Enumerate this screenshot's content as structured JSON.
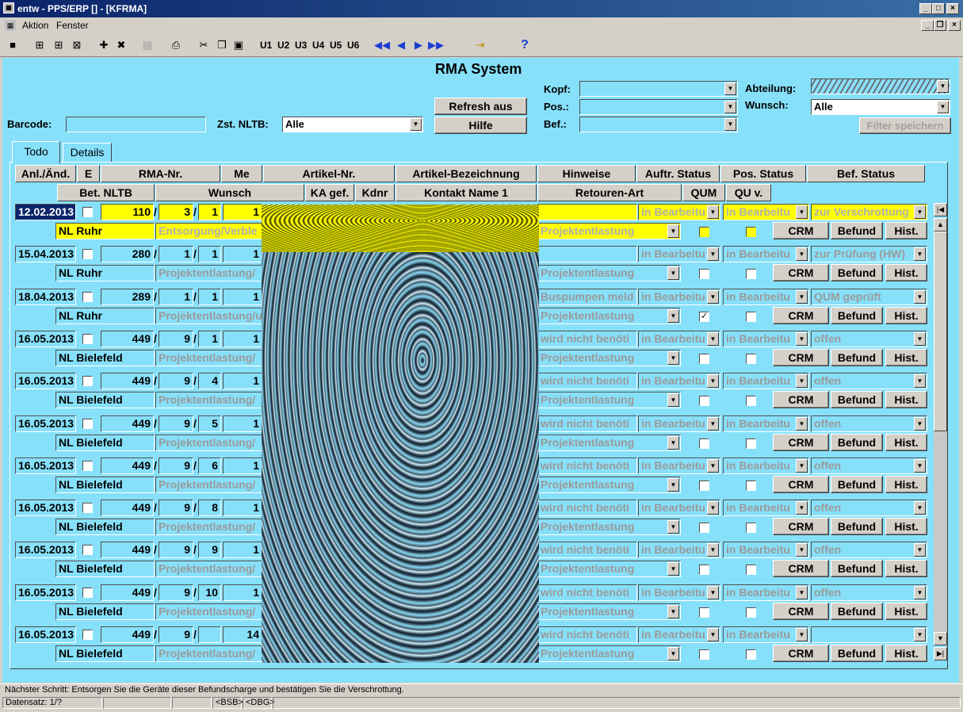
{
  "window": {
    "title": "entw - PPS/ERP [] - [KFRMA]"
  },
  "menu": {
    "items": [
      "Aktion",
      "Fenster"
    ]
  },
  "toolbar": {
    "user_buttons": [
      "U1",
      "U2",
      "U3",
      "U4",
      "U5",
      "U6"
    ]
  },
  "form": {
    "title": "RMA System",
    "barcode_label": "Barcode:",
    "zst_label": "Zst. NLTB:",
    "zst_value": "Alle",
    "refresh_label": "Refresh aus",
    "help_label": "Hilfe",
    "kopf_label": "Kopf:",
    "pos_label": "Pos.:",
    "bef_label": "Bef.:",
    "abteilung_label": "Abteilung:",
    "wunsch_label": "Wunsch:",
    "wunsch_value": "Alle",
    "filter_label": "Filter speichern"
  },
  "tabs": [
    "Todo",
    "Details"
  ],
  "headers_row1": [
    "Anl./Änd.",
    "E",
    "RMA-Nr.",
    "Me",
    "Artikel-Nr.",
    "Artikel-Bezeichnung",
    "Hinweise",
    "Auftr. Status",
    "Pos. Status",
    "Bef. Status"
  ],
  "headers_row2": [
    "Bet. NLTB",
    "Wunsch",
    "KA gef.",
    "Kdnr",
    "Kontakt Name 1",
    "Retouren-Art",
    "QUM",
    "QU v."
  ],
  "row_buttons": [
    "CRM",
    "Befund",
    "Hist."
  ],
  "records": [
    {
      "date": "12.02.2013",
      "rma": "110",
      "pos": "3",
      "sub": "1",
      "me": "1",
      "nltb": "NL Ruhr",
      "wunsch": "Entsorgung/Verble",
      "hinweis": "",
      "auftr": "in Bearbeitu",
      "posst": "in Bearbeitu",
      "bef": "zur Verschrottung",
      "retour": "Projektentlastung",
      "qum": false,
      "quv": false
    },
    {
      "date": "15.04.2013",
      "rma": "280",
      "pos": "1",
      "sub": "1",
      "me": "1",
      "nltb": "NL Ruhr",
      "wunsch": "Projektentlastung/",
      "hinweis": "",
      "auftr": "in Bearbeitu",
      "posst": "in Bearbeitu",
      "bef": "zur Prüfung (HW)",
      "retour": "Projektentlastung",
      "qum": false,
      "quv": false
    },
    {
      "date": "18.04.2013",
      "rma": "289",
      "pos": "1",
      "sub": "1",
      "me": "1",
      "nltb": "NL Ruhr",
      "wunsch": "Projektentlastung/u",
      "hinweis": "Buspumpen meld",
      "auftr": "in Bearbeitu",
      "posst": "in Bearbeitu",
      "bef": "QUM geprüft",
      "retour": "Projektentlastung",
      "qum": true,
      "quv": false
    },
    {
      "date": "16.05.2013",
      "rma": "449",
      "pos": "9",
      "sub": "1",
      "me": "1",
      "nltb": "NL Bielefeld",
      "wunsch": "Projektentlastung/",
      "hinweis": "wird nicht benöti",
      "auftr": "in Bearbeitu",
      "posst": "in Bearbeitu",
      "bef": "offen",
      "retour": "Projektentlastung",
      "qum": false,
      "quv": false
    },
    {
      "date": "16.05.2013",
      "rma": "449",
      "pos": "9",
      "sub": "4",
      "me": "1",
      "nltb": "NL Bielefeld",
      "wunsch": "Projektentlastung/",
      "hinweis": "wird nicht benöti",
      "auftr": "in Bearbeitu",
      "posst": "in Bearbeitu",
      "bef": "offen",
      "retour": "Projektentlastung",
      "qum": false,
      "quv": false
    },
    {
      "date": "16.05.2013",
      "rma": "449",
      "pos": "9",
      "sub": "5",
      "me": "1",
      "nltb": "NL Bielefeld",
      "wunsch": "Projektentlastung/",
      "hinweis": "wird nicht benöti",
      "auftr": "in Bearbeitu",
      "posst": "in Bearbeitu",
      "bef": "offen",
      "retour": "Projektentlastung",
      "qum": false,
      "quv": false
    },
    {
      "date": "16.05.2013",
      "rma": "449",
      "pos": "9",
      "sub": "6",
      "me": "1",
      "nltb": "NL Bielefeld",
      "wunsch": "Projektentlastung/",
      "hinweis": "wird nicht benöti",
      "auftr": "in Bearbeitu",
      "posst": "in Bearbeitu",
      "bef": "offen",
      "retour": "Projektentlastung",
      "qum": false,
      "quv": false
    },
    {
      "date": "16.05.2013",
      "rma": "449",
      "pos": "9",
      "sub": "8",
      "me": "1",
      "nltb": "NL Bielefeld",
      "wunsch": "Projektentlastung/",
      "hinweis": "wird nicht benöti",
      "auftr": "in Bearbeitu",
      "posst": "in Bearbeitu",
      "bef": "offen",
      "retour": "Projektentlastung",
      "qum": false,
      "quv": false
    },
    {
      "date": "16.05.2013",
      "rma": "449",
      "pos": "9",
      "sub": "9",
      "me": "1",
      "nltb": "NL Bielefeld",
      "wunsch": "Projektentlastung/",
      "hinweis": "wird nicht benöti",
      "auftr": "in Bearbeitu",
      "posst": "in Bearbeitu",
      "bef": "offen",
      "retour": "Projektentlastung",
      "qum": false,
      "quv": false
    },
    {
      "date": "16.05.2013",
      "rma": "449",
      "pos": "9",
      "sub": "10",
      "me": "1",
      "nltb": "NL Bielefeld",
      "wunsch": "Projektentlastung/",
      "hinweis": "wird nicht benöti",
      "auftr": "in Bearbeitu",
      "posst": "in Bearbeitu",
      "bef": "offen",
      "retour": "Projektentlastung",
      "qum": false,
      "quv": false
    },
    {
      "date": "16.05.2013",
      "rma": "449",
      "pos": "9",
      "sub": "",
      "me": "14",
      "nltb": "NL Bielefeld",
      "wunsch": "Projektentlastung/",
      "hinweis": "wird nicht benöti",
      "auftr": "in Bearbeitu",
      "posst": "in Bearbeitu",
      "bef": "",
      "retour": "Projektentlastung",
      "qum": false,
      "quv": false
    }
  ],
  "status": {
    "message": "Nächster Schritt: Entsorgen Sie die Geräte dieser Befundscharge und bestätigen Sie die Verschrottung.",
    "record": "Datensatz: 1/?",
    "bsb": "<BSB>",
    "dbg": "<DBG>"
  }
}
